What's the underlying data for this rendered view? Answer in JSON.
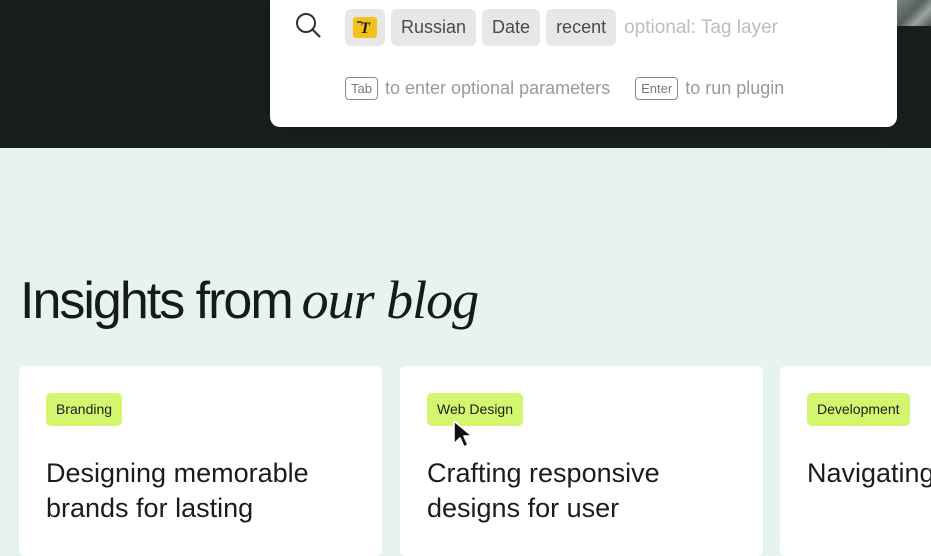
{
  "colors": {
    "dark_band": "#1b1e1e",
    "page_background": "#e6f3ef",
    "tag_green": "#d4f56e",
    "plugin_yellow": "#f2c21b"
  },
  "command_palette": {
    "search_icon": "search-icon",
    "plugin_icon": "text-translate-icon",
    "chips": [
      "Russian",
      "Date",
      "recent"
    ],
    "input_placeholder": "optional: Tag layer",
    "hints": {
      "tab_key": "Tab",
      "tab_text": "to enter optional parameters",
      "enter_key": "Enter",
      "enter_text": "to run plugin"
    }
  },
  "blog": {
    "heading_regular": "Insights from",
    "heading_accent": "our blog",
    "cards": [
      {
        "tag": "Branding",
        "title": "Designing memorable brands for lasting"
      },
      {
        "tag": "Web Design",
        "title": "Crafting responsive designs for user"
      },
      {
        "tag": "Development",
        "title": "Navigating development"
      }
    ]
  },
  "cursor_icon": "arrow-cursor-icon"
}
